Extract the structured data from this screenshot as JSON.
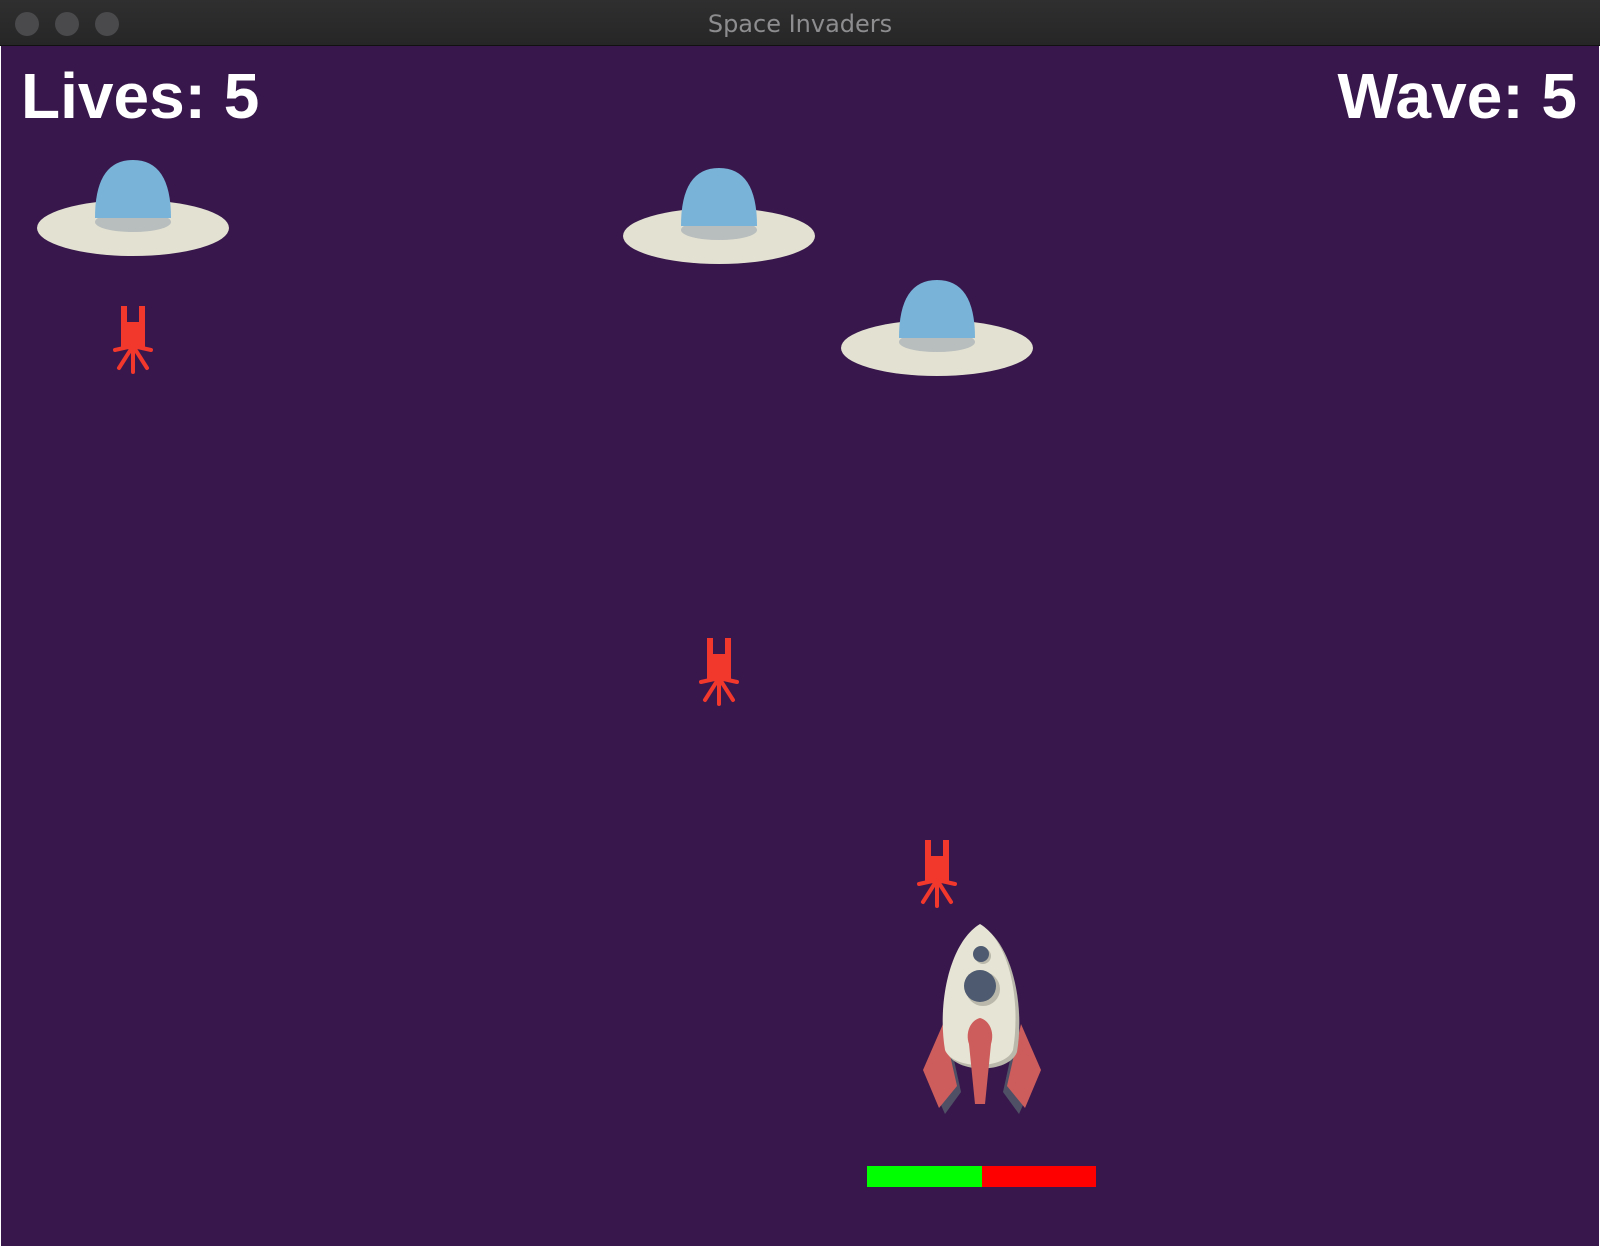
{
  "window": {
    "title": "Space Invaders"
  },
  "hud": {
    "lives_text": "Lives: 5",
    "wave_text": "Wave: 5"
  },
  "game": {
    "lives": 5,
    "wave": 5,
    "player_health_fraction": 0.5,
    "enemy_count": 3,
    "projectile_count": 3
  },
  "colors": {
    "background": "#38184c",
    "health_remaining": "#00ff00",
    "health_lost": "#ff0000",
    "ufo_body": "#e2e1d2",
    "ufo_dome": "#79b3d8",
    "rocket_body": "#e6e4d4",
    "rocket_fins": "#cd5d5c",
    "enemy_shot": "#f2372c",
    "hud_text": "#ffffff"
  },
  "icons": {
    "enemy": "ufo-icon",
    "player": "rocket-icon",
    "projectile": "enemy-bullet-icon"
  }
}
